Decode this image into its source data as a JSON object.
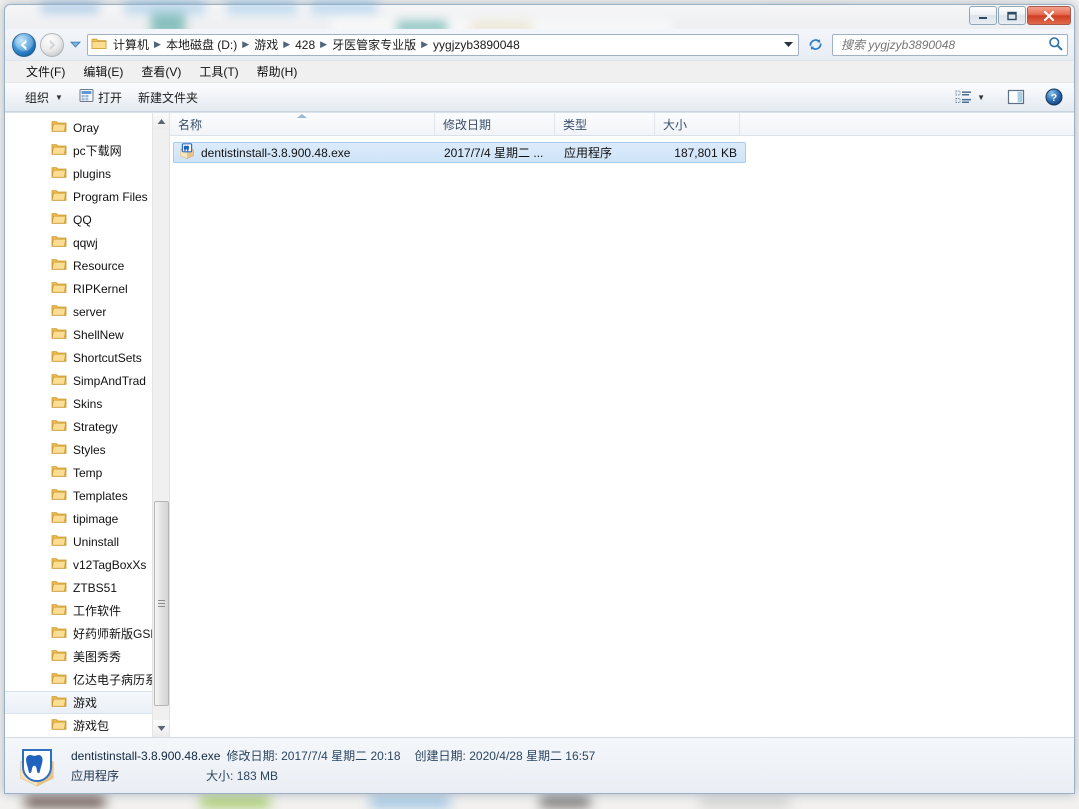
{
  "window": {
    "minimize_label": "最小化",
    "maximize_label": "最大化",
    "close_label": "关闭"
  },
  "nav": {
    "back_label": "后退",
    "forward_label": "前进",
    "history_label": "最近浏览的位置",
    "refresh_label": "刷新",
    "breadcrumbs": [
      "计算机",
      "本地磁盘 (D:)",
      "游戏",
      "428",
      "牙医管家专业版",
      "yygjzyb3890048"
    ],
    "separator": "▶"
  },
  "search": {
    "placeholder": "搜索 yygjzyb3890048",
    "value": "",
    "icon": "search-icon"
  },
  "menubar": {
    "items": [
      "文件(F)",
      "编辑(E)",
      "查看(V)",
      "工具(T)",
      "帮助(H)"
    ]
  },
  "toolbar": {
    "organize_label": "组织",
    "open_label": "打开",
    "newfolder_label": "新建文件夹",
    "views_label": "更改您的视图",
    "preview_label": "显示预览窗格",
    "help_label": "获取帮助"
  },
  "sidebar": {
    "items": [
      {
        "label": "Oray",
        "selected": false
      },
      {
        "label": "pc下载网",
        "selected": false
      },
      {
        "label": "plugins",
        "selected": false
      },
      {
        "label": "Program Files",
        "selected": false
      },
      {
        "label": "QQ",
        "selected": false
      },
      {
        "label": "qqwj",
        "selected": false
      },
      {
        "label": "Resource",
        "selected": false
      },
      {
        "label": "RIPKernel",
        "selected": false
      },
      {
        "label": "server",
        "selected": false
      },
      {
        "label": "ShellNew",
        "selected": false
      },
      {
        "label": "ShortcutSets",
        "selected": false
      },
      {
        "label": "SimpAndTrad",
        "selected": false
      },
      {
        "label": "Skins",
        "selected": false
      },
      {
        "label": "Strategy",
        "selected": false
      },
      {
        "label": "Styles",
        "selected": false
      },
      {
        "label": "Temp",
        "selected": false
      },
      {
        "label": "Templates",
        "selected": false
      },
      {
        "label": "tipimage",
        "selected": false
      },
      {
        "label": "Uninstall",
        "selected": false
      },
      {
        "label": "v12TagBoxXs",
        "selected": false
      },
      {
        "label": "ZTBS51",
        "selected": false
      },
      {
        "label": "工作软件",
        "selected": false
      },
      {
        "label": "好药师新版GSP",
        "selected": false
      },
      {
        "label": "美图秀秀",
        "selected": false
      },
      {
        "label": "亿达电子病历系",
        "selected": false
      },
      {
        "label": "游戏",
        "selected": true
      },
      {
        "label": "游戏包",
        "selected": false
      }
    ]
  },
  "filelist": {
    "columns": [
      {
        "label": "名称",
        "sorted": "asc"
      },
      {
        "label": "修改日期",
        "sorted": ""
      },
      {
        "label": "类型",
        "sorted": ""
      },
      {
        "label": "大小",
        "sorted": ""
      }
    ],
    "rows": [
      {
        "name": "dentistinstall-3.8.900.48.exe",
        "date": "2017/7/4 星期二 ...",
        "type": "应用程序",
        "size": "187,801 KB",
        "selected": true,
        "icon": "exe-installer-icon"
      }
    ]
  },
  "statusbar": {
    "filename": "dentistinstall-3.8.900.48.exe",
    "modified_label": "修改日期:",
    "modified_value": "2017/7/4 星期二 20:18",
    "created_label": "创建日期:",
    "created_value": "2020/4/28 星期二 16:57",
    "type_value": "应用程序",
    "size_label": "大小:",
    "size_value": "183 MB",
    "icon": "tooth-box-icon"
  },
  "colors": {
    "accent": "#3f8fd2",
    "selection_fill": "#cfe4f8",
    "selection_border": "#a8cdf0",
    "folder_gold": "#fdd97a",
    "close_red": "#cf3c22",
    "header_text": "#39506b"
  }
}
